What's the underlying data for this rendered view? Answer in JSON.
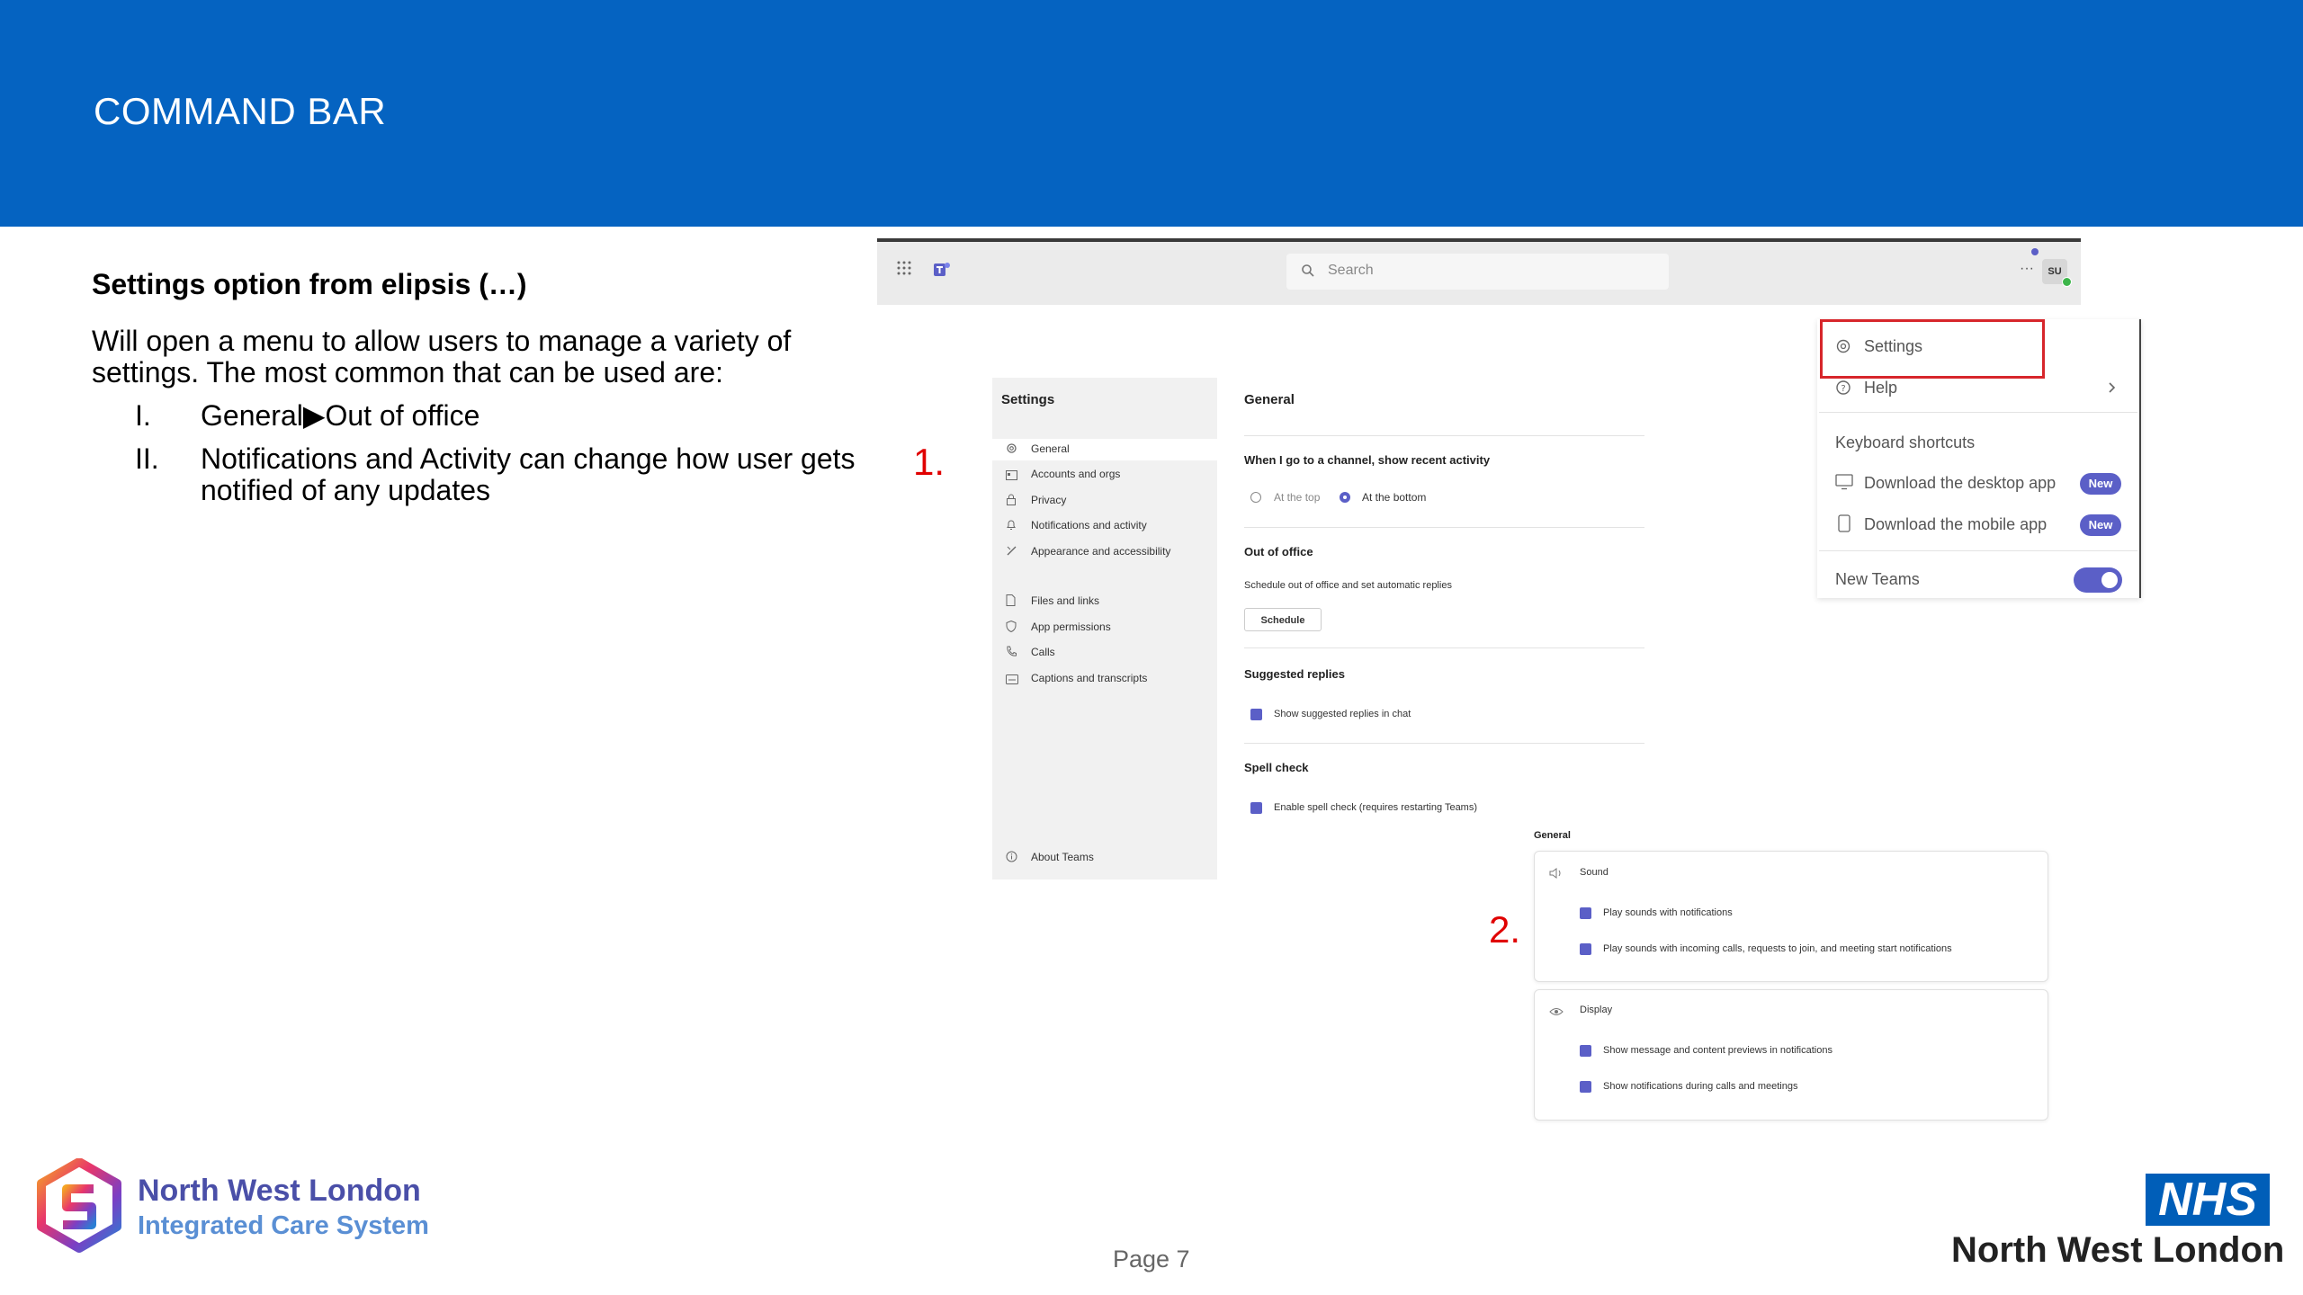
{
  "header": {
    "title": "COMMAND BAR",
    "color": "#0563c1"
  },
  "body": {
    "heading": "Settings option from elipsis (…)",
    "paragraph": "Will open a menu to allow users to manage a variety of settings. The most common that can be used are:",
    "list": [
      {
        "num": "I.",
        "text": "General▶Out of office"
      },
      {
        "num": "II.",
        "text": "Notifications and Activity can change how user gets notified of any updates"
      }
    ]
  },
  "markers": {
    "one": "1.",
    "two": "2."
  },
  "teams": {
    "search_placeholder": "Search",
    "avatar": "SU",
    "more": "···"
  },
  "settings_panel": {
    "title": "Settings",
    "items": [
      {
        "label": "General",
        "icon": "gear-icon"
      },
      {
        "label": "Accounts and orgs",
        "icon": "accounts-icon"
      },
      {
        "label": "Privacy",
        "icon": "lock-icon"
      },
      {
        "label": "Notifications and activity",
        "icon": "bell-icon"
      },
      {
        "label": "Appearance and accessibility",
        "icon": "brush-icon"
      },
      {
        "label": "Files and links",
        "icon": "file-icon"
      },
      {
        "label": "App permissions",
        "icon": "shield-icon"
      },
      {
        "label": "Calls",
        "icon": "phone-icon"
      },
      {
        "label": "Captions and transcripts",
        "icon": "captions-icon"
      }
    ],
    "about": "About Teams"
  },
  "general": {
    "title": "General",
    "channel_heading": "When I go to a channel, show recent activity",
    "radio_top": "At the top",
    "radio_bottom": "At the bottom",
    "ooo_heading": "Out of office",
    "ooo_desc": "Schedule out of office and set automatic replies",
    "schedule_button": "Schedule",
    "suggested_heading": "Suggested replies",
    "suggested_option": "Show suggested replies in chat",
    "spell_heading": "Spell check",
    "spell_option": "Enable spell check (requires restarting Teams)"
  },
  "dropdown": {
    "settings": "Settings",
    "help": "Help",
    "keyboard": "Keyboard shortcuts",
    "desktop": "Download the desktop app",
    "mobile": "Download the mobile app",
    "new_badge": "New",
    "new_teams": "New Teams",
    "new_teams_on": true
  },
  "notifications": {
    "title": "General",
    "sound": "Sound",
    "sound_opts": [
      "Play sounds with notifications",
      "Play sounds with incoming calls, requests to join, and meeting start notifications"
    ],
    "display": "Display",
    "display_opts": [
      "Show message and content previews in notifications",
      "Show notifications during calls and meetings"
    ]
  },
  "footer": {
    "ics_line1": "North West London",
    "ics_line2": "Integrated Care System",
    "page": "Page 7",
    "nhs_logo": "NHS",
    "nhs_name": "North West London",
    "nhs_color": "#005eb8",
    "ics_color": "#4a4fa8"
  }
}
